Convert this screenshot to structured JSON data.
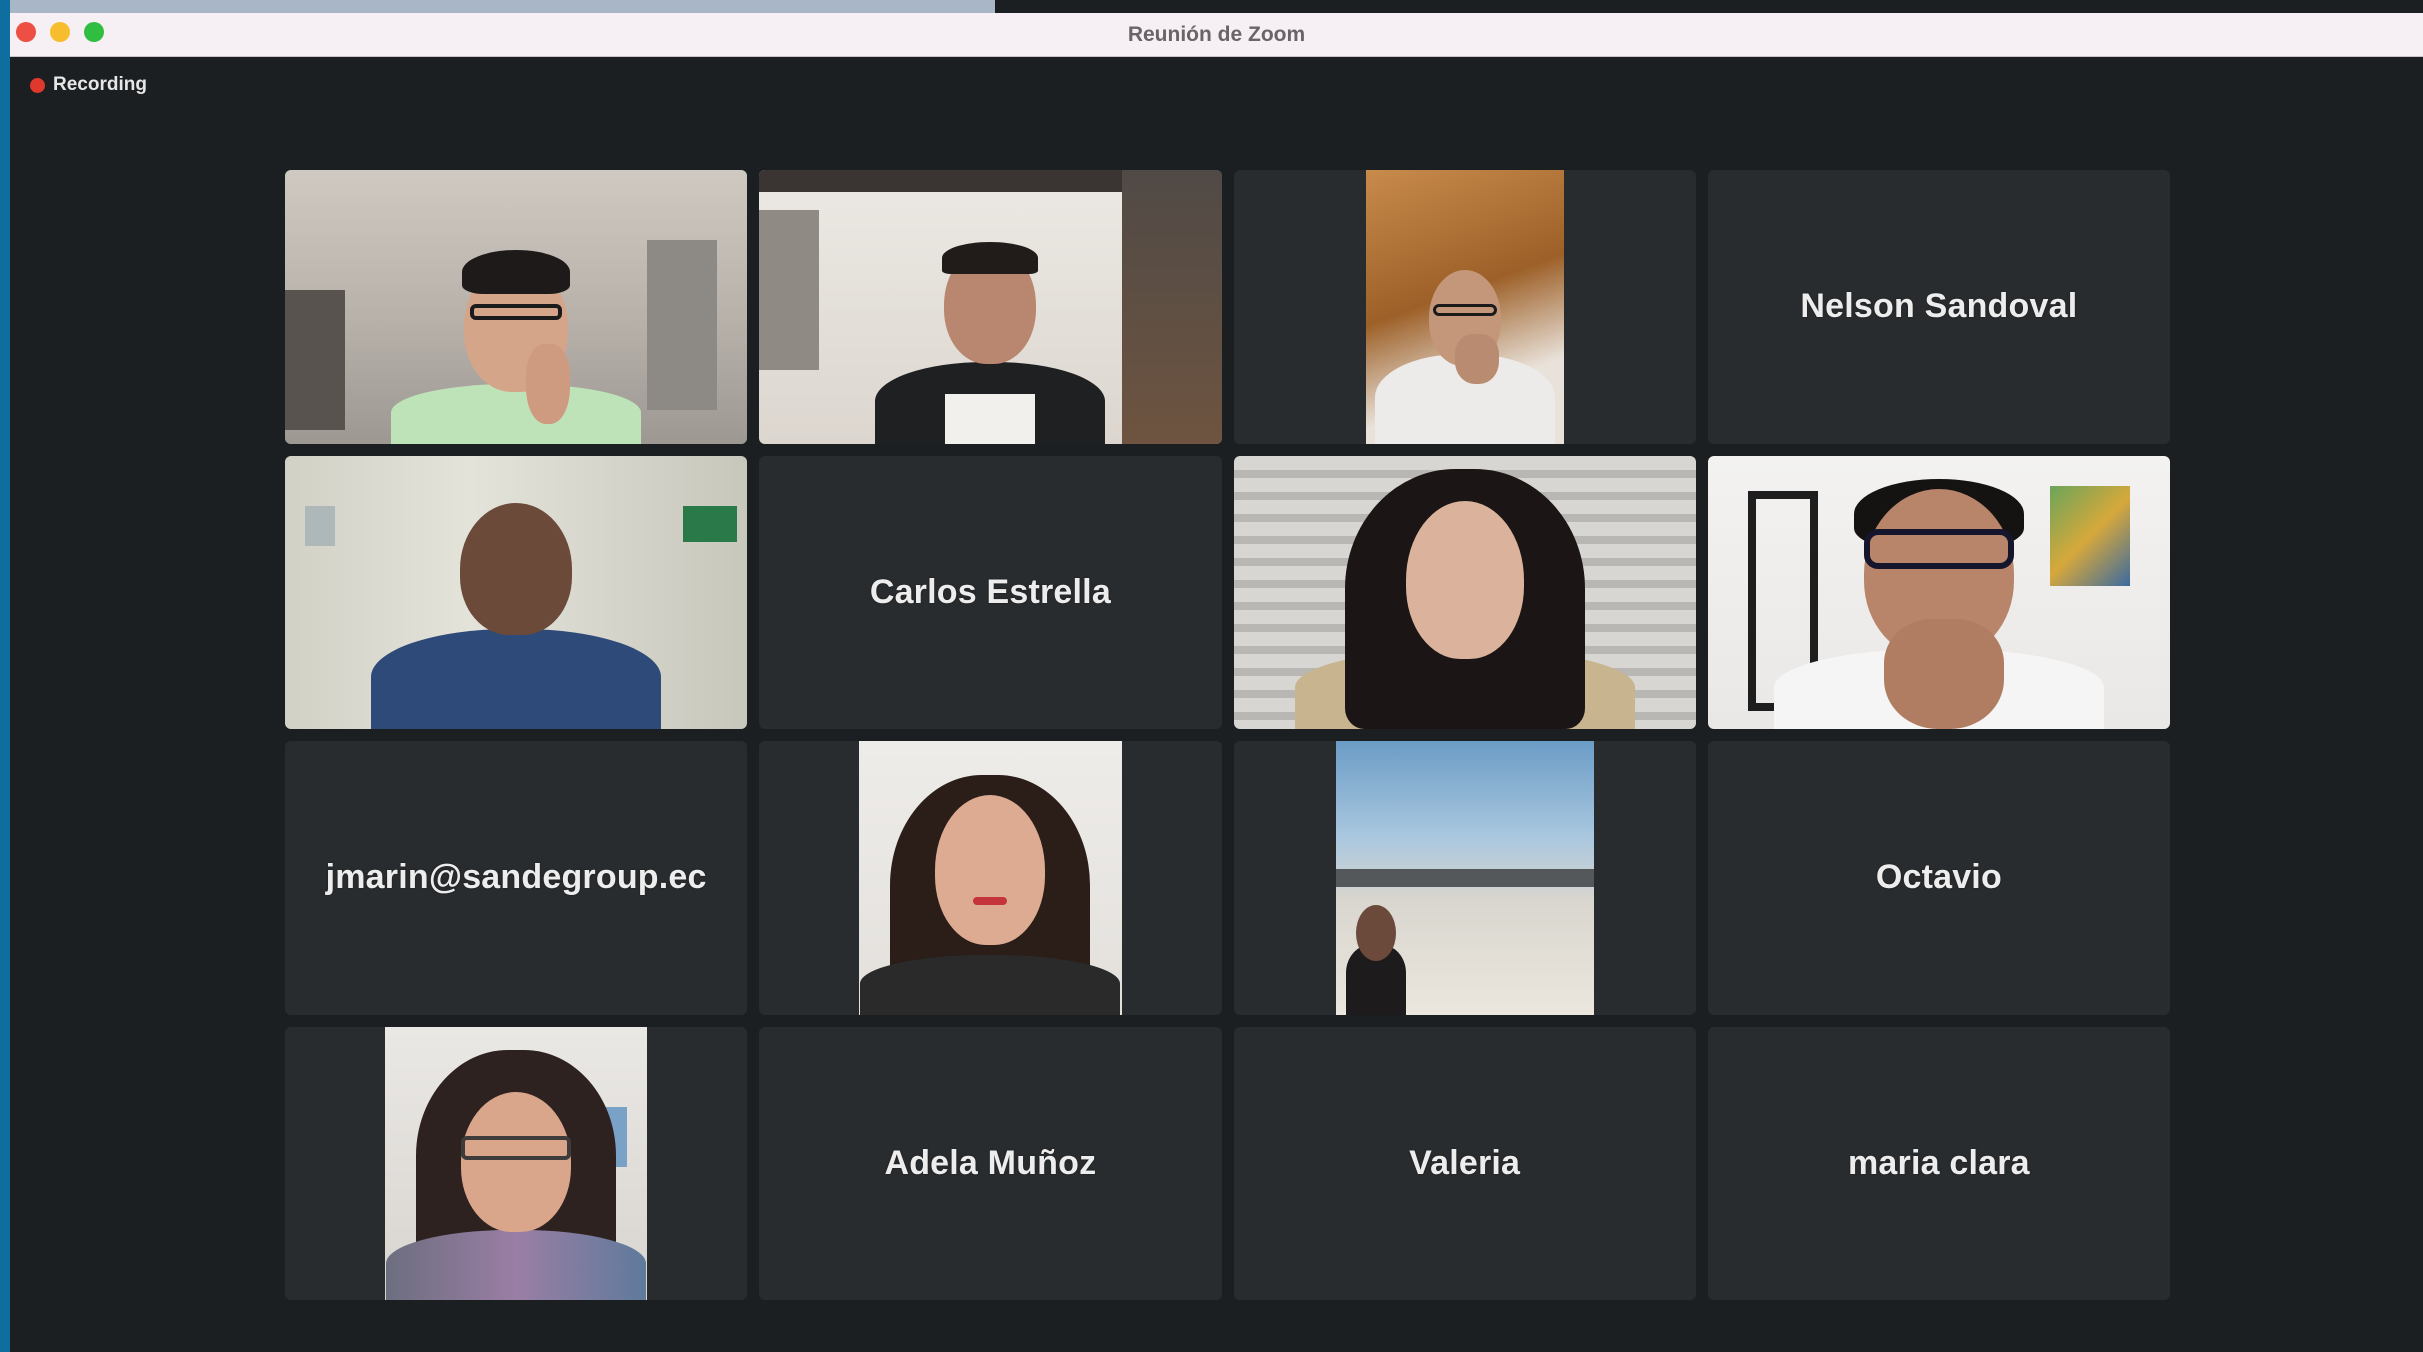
{
  "window": {
    "title": "Reunión de Zoom"
  },
  "recording": {
    "label": "Recording"
  },
  "colors": {
    "active_speaker_border": "#35c14b",
    "recording_dot": "#e0382c",
    "tile_bg": "#292c2e"
  },
  "participants": [
    {
      "type": "video",
      "description_icon": "participant-video"
    },
    {
      "type": "video",
      "description_icon": "participant-video"
    },
    {
      "type": "video",
      "description_icon": "participant-video"
    },
    {
      "type": "name",
      "name": "Nelson Sandoval"
    },
    {
      "type": "video",
      "description_icon": "participant-video"
    },
    {
      "type": "name",
      "name": "Carlos Estrella"
    },
    {
      "type": "video",
      "description_icon": "participant-video"
    },
    {
      "type": "video",
      "description_icon": "participant-video"
    },
    {
      "type": "name",
      "name": "jmarin@sandegroup.ec"
    },
    {
      "type": "video",
      "description_icon": "participant-video"
    },
    {
      "type": "video",
      "description_icon": "participant-video"
    },
    {
      "type": "name",
      "name": "Octavio"
    },
    {
      "type": "video",
      "description_icon": "participant-video"
    },
    {
      "type": "name",
      "name": "Adela Muñoz"
    },
    {
      "type": "name",
      "name": "Valeria"
    },
    {
      "type": "name",
      "name": "maria clara"
    }
  ]
}
